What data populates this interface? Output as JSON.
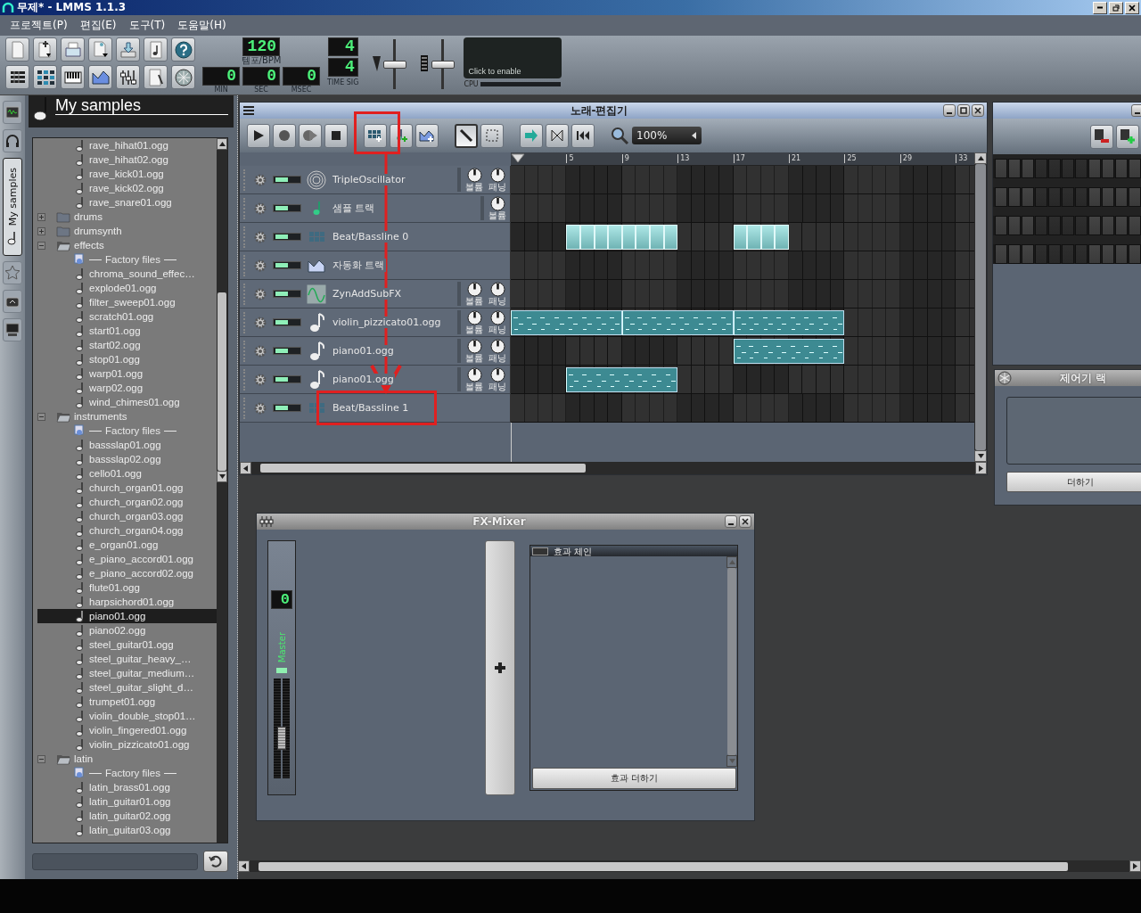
{
  "window": {
    "title": "무제* - LMMS 1.1.3"
  },
  "menu": [
    {
      "label": "프로젝트(P)"
    },
    {
      "label": "편집(E)"
    },
    {
      "label": "도구(T)"
    },
    {
      "label": "도움말(H)"
    }
  ],
  "toolbar": {
    "tempo": {
      "value": "120",
      "label": "템포/BPM"
    },
    "time": [
      {
        "value": "0",
        "label": "MIN"
      },
      {
        "value": "0",
        "label": "SEC"
      },
      {
        "value": "0",
        "label": "MSEC"
      }
    ],
    "time_sig": {
      "numerator": "4",
      "denominator": "4",
      "label": "TIME SIG"
    },
    "master_volume": {
      "level": 0.5
    },
    "master_pitch": {
      "level": 0.5
    },
    "cpu": {
      "message": "Click to enable",
      "label": "CPU"
    }
  },
  "sidebar_tabs": [
    {
      "kind": "instruments",
      "selected": false
    },
    {
      "kind": "projects",
      "selected": false
    },
    {
      "kind": "samples",
      "label": "My samples",
      "selected": true
    },
    {
      "kind": "presets",
      "selected": false
    },
    {
      "kind": "home",
      "selected": false
    },
    {
      "kind": "computer",
      "selected": false
    }
  ],
  "browser": {
    "title": "My samples",
    "tree": [
      {
        "kind": "continuation",
        "children": [
          {
            "kind": "file",
            "label": "rave_hihat01.ogg",
            "selected": false
          },
          {
            "kind": "file",
            "label": "rave_hihat02.ogg",
            "selected": false
          },
          {
            "kind": "file",
            "label": "rave_kick01.ogg",
            "selected": false
          },
          {
            "kind": "file",
            "label": "rave_kick02.ogg",
            "selected": false
          },
          {
            "kind": "file",
            "label": "rave_snare01.ogg",
            "selected": false
          }
        ]
      },
      {
        "kind": "folder",
        "label": "drums",
        "expanded": false
      },
      {
        "kind": "folder",
        "label": "drumsynth",
        "expanded": false
      },
      {
        "kind": "folder",
        "label": "effects",
        "expanded": true,
        "children": [
          {
            "kind": "factory",
            "label": "Factory files"
          },
          {
            "kind": "file",
            "label": "chroma_sound_effec…",
            "selected": false
          },
          {
            "kind": "file",
            "label": "explode01.ogg",
            "selected": false
          },
          {
            "kind": "file",
            "label": "filter_sweep01.ogg",
            "selected": false
          },
          {
            "kind": "file",
            "label": "scratch01.ogg",
            "selected": false
          },
          {
            "kind": "file",
            "label": "start01.ogg",
            "selected": false
          },
          {
            "kind": "file",
            "label": "start02.ogg",
            "selected": false
          },
          {
            "kind": "file",
            "label": "stop01.ogg",
            "selected": false
          },
          {
            "kind": "file",
            "label": "warp01.ogg",
            "selected": false
          },
          {
            "kind": "file",
            "label": "warp02.ogg",
            "selected": false
          },
          {
            "kind": "file",
            "label": "wind_chimes01.ogg",
            "selected": false
          }
        ]
      },
      {
        "kind": "folder",
        "label": "instruments",
        "expanded": true,
        "children": [
          {
            "kind": "factory",
            "label": "Factory files"
          },
          {
            "kind": "file",
            "label": "bassslap01.ogg",
            "selected": false
          },
          {
            "kind": "file",
            "label": "bassslap02.ogg",
            "selected": false
          },
          {
            "kind": "file",
            "label": "cello01.ogg",
            "selected": false
          },
          {
            "kind": "file",
            "label": "church_organ01.ogg",
            "selected": false
          },
          {
            "kind": "file",
            "label": "church_organ02.ogg",
            "selected": false
          },
          {
            "kind": "file",
            "label": "church_organ03.ogg",
            "selected": false
          },
          {
            "kind": "file",
            "label": "church_organ04.ogg",
            "selected": false
          },
          {
            "kind": "file",
            "label": "e_organ01.ogg",
            "selected": false
          },
          {
            "kind": "file",
            "label": "e_piano_accord01.ogg",
            "selected": false
          },
          {
            "kind": "file",
            "label": "e_piano_accord02.ogg",
            "selected": false
          },
          {
            "kind": "file",
            "label": "flute01.ogg",
            "selected": false
          },
          {
            "kind": "file",
            "label": "harpsichord01.ogg",
            "selected": false
          },
          {
            "kind": "file",
            "label": "piano01.ogg",
            "selected": true
          },
          {
            "kind": "file",
            "label": "piano02.ogg",
            "selected": false
          },
          {
            "kind": "file",
            "label": "steel_guitar01.ogg",
            "selected": false
          },
          {
            "kind": "file",
            "label": "steel_guitar_heavy_…",
            "selected": false
          },
          {
            "kind": "file",
            "label": "steel_guitar_medium…",
            "selected": false
          },
          {
            "kind": "file",
            "label": "steel_guitar_slight_d…",
            "selected": false
          },
          {
            "kind": "file",
            "label": "trumpet01.ogg",
            "selected": false
          },
          {
            "kind": "file",
            "label": "violin_double_stop01…",
            "selected": false
          },
          {
            "kind": "file",
            "label": "violin_fingered01.ogg",
            "selected": false
          },
          {
            "kind": "file",
            "label": "violin_pizzicato01.ogg",
            "selected": false
          }
        ]
      },
      {
        "kind": "folder",
        "label": "latin",
        "expanded": true,
        "children": [
          {
            "kind": "factory",
            "label": "Factory files"
          },
          {
            "kind": "file",
            "label": "latin_brass01.ogg",
            "selected": false
          },
          {
            "kind": "file",
            "label": "latin_guitar01.ogg",
            "selected": false
          },
          {
            "kind": "file",
            "label": "latin_guitar02.ogg",
            "selected": false
          },
          {
            "kind": "file",
            "label": "latin_guitar03.ogg",
            "selected": false
          }
        ]
      }
    ]
  },
  "song_editor": {
    "title": "노래-편집기",
    "tools": [
      {
        "kind": "draw",
        "selected": true
      },
      {
        "kind": "select",
        "selected": false
      }
    ],
    "zoom": "100%",
    "ruler": [
      "5",
      "9",
      "13",
      "17",
      "21",
      "25",
      "29",
      "33"
    ],
    "tracks": [
      {
        "kind": "oscillator",
        "name": "TripleOscillator",
        "muted": false,
        "knobs": [
          {
            "label": "볼륨"
          },
          {
            "label": "패닝"
          }
        ]
      },
      {
        "kind": "sample",
        "name": "샘플 트랙",
        "muted": false,
        "knobs": [
          {
            "label": "볼륨"
          }
        ]
      },
      {
        "kind": "beat",
        "name": "Beat/Bassline 0",
        "muted": false,
        "cells": [
          {
            "filled": false
          },
          {
            "filled": false
          },
          {
            "filled": false
          },
          {
            "filled": false
          },
          {
            "filled": true
          },
          {
            "filled": true
          },
          {
            "filled": true
          },
          {
            "filled": true
          },
          {
            "filled": true
          },
          {
            "filled": true
          },
          {
            "filled": true
          },
          {
            "filled": true
          },
          {
            "filled": false
          },
          {
            "filled": false
          },
          {
            "filled": false
          },
          {
            "filled": false
          },
          {
            "filled": true
          },
          {
            "filled": true
          },
          {
            "filled": true
          },
          {
            "filled": true
          },
          {
            "filled": false
          },
          {
            "filled": false
          },
          {
            "filled": false
          },
          {
            "filled": false
          }
        ]
      },
      {
        "kind": "automation",
        "name": "자동화 트랙",
        "muted": false
      },
      {
        "kind": "zyn",
        "name": "ZynAddSubFX",
        "muted": false,
        "knobs": [
          {
            "label": "볼륨"
          },
          {
            "label": "패닝"
          }
        ]
      },
      {
        "kind": "audiofile",
        "name": "violin_pizzicato01.ogg",
        "muted": false,
        "knobs": [
          {
            "label": "볼륨"
          },
          {
            "label": "패닝"
          }
        ],
        "cells": [
          {
            "filled": true,
            "start": true
          },
          {
            "filled": true,
            "start": false
          },
          {
            "filled": true,
            "start": false
          },
          {
            "filled": true,
            "start": false
          },
          {
            "filled": true,
            "start": false
          },
          {
            "filled": true,
            "start": false
          },
          {
            "filled": true,
            "start": false
          },
          {
            "filled": true,
            "start": false
          },
          {
            "filled": true,
            "start": true
          },
          {
            "filled": true,
            "start": false
          },
          {
            "filled": true,
            "start": false
          },
          {
            "filled": true,
            "start": false
          },
          {
            "filled": true,
            "start": false
          },
          {
            "filled": true,
            "start": false
          },
          {
            "filled": true,
            "start": false
          },
          {
            "filled": true,
            "start": false
          },
          {
            "filled": true,
            "start": true
          },
          {
            "filled": true,
            "start": false
          },
          {
            "filled": true,
            "start": false
          },
          {
            "filled": true,
            "start": false
          },
          {
            "filled": true,
            "start": false
          },
          {
            "filled": true,
            "start": false
          },
          {
            "filled": true,
            "start": false
          },
          {
            "filled": true,
            "start": false
          }
        ]
      },
      {
        "kind": "audiofile",
        "name": "piano01.ogg",
        "muted": false,
        "knobs": [
          {
            "label": "볼륨"
          },
          {
            "label": "패닝"
          }
        ],
        "cells": [
          {
            "filled": false
          },
          {
            "filled": false
          },
          {
            "filled": false
          },
          {
            "filled": false
          },
          {
            "filled": false
          },
          {
            "filled": false
          },
          {
            "filled": false
          },
          {
            "filled": false
          },
          {
            "filled": false
          },
          {
            "filled": false
          },
          {
            "filled": false
          },
          {
            "filled": false
          },
          {
            "filled": false
          },
          {
            "filled": false
          },
          {
            "filled": false
          },
          {
            "filled": false
          },
          {
            "filled": true,
            "start": true
          },
          {
            "filled": true,
            "start": false
          },
          {
            "filled": true,
            "start": false
          },
          {
            "filled": true,
            "start": false
          },
          {
            "filled": true,
            "start": false
          },
          {
            "filled": true,
            "start": false
          },
          {
            "filled": true,
            "start": false
          },
          {
            "filled": true,
            "start": false
          }
        ]
      },
      {
        "kind": "audiofile",
        "name": "piano01.ogg",
        "muted": false,
        "knobs": [
          {
            "label": "볼륨"
          },
          {
            "label": "패닝"
          }
        ],
        "cells": [
          {
            "filled": false
          },
          {
            "filled": false
          },
          {
            "filled": false
          },
          {
            "filled": false
          },
          {
            "filled": true,
            "start": true
          },
          {
            "filled": true,
            "start": false
          },
          {
            "filled": true,
            "start": false
          },
          {
            "filled": true,
            "start": false
          },
          {
            "filled": true,
            "start": false
          },
          {
            "filled": true,
            "start": false
          },
          {
            "filled": true,
            "start": false
          },
          {
            "filled": true,
            "start": false
          },
          {
            "filled": false
          },
          {
            "filled": false
          },
          {
            "filled": false
          },
          {
            "filled": false
          },
          {
            "filled": false
          },
          {
            "filled": false
          },
          {
            "filled": false
          },
          {
            "filled": false
          },
          {
            "filled": false
          },
          {
            "filled": false
          },
          {
            "filled": false
          },
          {
            "filled": false
          }
        ]
      },
      {
        "kind": "beat",
        "name": "Beat/Bassline 1",
        "muted": false
      }
    ]
  },
  "controller_rack": {
    "title": "제어기 랙",
    "add_button": "더하기"
  },
  "fx_mixer": {
    "title": "FX-Mixer",
    "master": {
      "number": "0",
      "name": "Master",
      "fader": {
        "level": 0.4
      }
    },
    "effects_chain": {
      "title": "효과 체인",
      "enabled": false,
      "add_button": "효과 더하기"
    }
  }
}
